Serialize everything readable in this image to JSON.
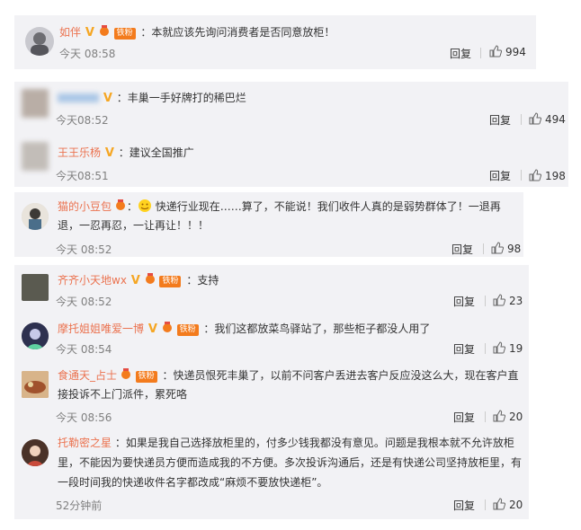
{
  "comments": [
    {
      "user": "如伴",
      "text": "：本就应该先询问消费者是否同意放柜！",
      "time": "今天 08:58",
      "reply": "回复",
      "likes": "994"
    },
    {
      "user": "",
      "text": "：丰巢一手好牌打的稀巴烂",
      "time": "今天08:52",
      "reply": "回复",
      "likes": "494"
    },
    {
      "user": "王王乐杨",
      "text": "：建议全国推广",
      "time": "今天08:51",
      "reply": "回复",
      "likes": "198"
    },
    {
      "user": "猫的小豆包",
      "text": "快递行业现在……算了，不能说！我们收件人真的是弱势群体了！一退再退，一忍再忍，一让再让！！！",
      "time": "今天 08:52",
      "reply": "回复",
      "likes": "98"
    },
    {
      "user": "齐齐小天地wx",
      "text": "：支持",
      "time": "今天 08:52",
      "reply": "回复",
      "likes": "23"
    },
    {
      "user": "摩托姐姐唯爱一博",
      "text": "：我们这都放菜鸟驿站了，那些柜子都没人用了",
      "time": "今天 08:54",
      "reply": "回复",
      "likes": "19"
    },
    {
      "user": "食通天_占士",
      "text": "：快递员恨死丰巢了，以前不问客户丢进去客户反应没这么大，现在客户直接投诉不上门派件，累死咯",
      "time": "今天 08:56",
      "reply": "回复",
      "likes": "20"
    },
    {
      "user": "托勒密之星",
      "text": "：如果是我自己选择放柜里的，付多少钱我都没有意见。问题是我根本就不允许放柜里，不能因为要快递员方便而造成我的不方便。多次投诉沟通后，还是有快递公司坚持放柜里，有一段时间我的快递收件名字都改成“麻烦不要放快递柜”。",
      "time": "52分钟前",
      "reply": "回复",
      "likes": "20"
    }
  ],
  "badges": {
    "v": "V",
    "fan": "铁粉"
  },
  "colors": {
    "username": "#eb7350",
    "card_bg": "#f2f2f5",
    "badge": "#f37b1d",
    "v": "#f5a623"
  }
}
